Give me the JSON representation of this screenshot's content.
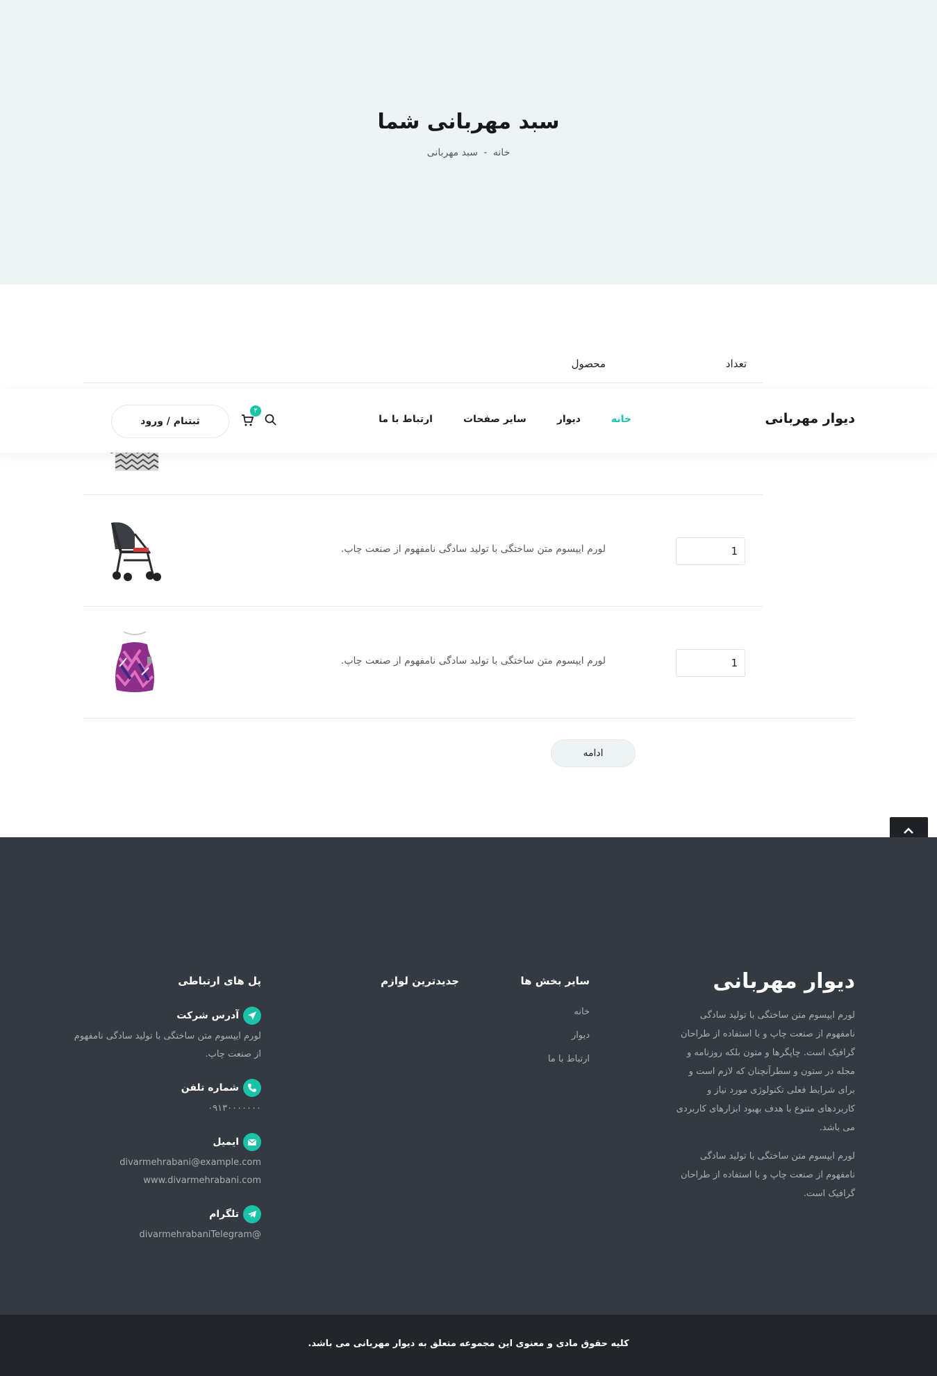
{
  "hero": {
    "title": "سبد مهربانی شما",
    "breadcrumb_home": "خانه",
    "breadcrumb_sep": "-",
    "breadcrumb_current": "سبد مهربانی"
  },
  "cart": {
    "col_quantity": "تعداد",
    "col_product": "محصول",
    "rows": [
      {
        "quantity": "1",
        "description": "لورم ایپسوم متن ساختگی با تولید سادگی نامفهوم از صنعت چاپ.",
        "image": "stroller-icon"
      },
      {
        "quantity": "1",
        "description": "لورم ایپسوم متن ساختگی با تولید سادگی نامفهوم از صنعت چاپ.",
        "image": "swimsuit-icon"
      }
    ],
    "continue_label": "ادامه"
  },
  "navbar": {
    "brand": "دیوار مهربانی",
    "menu": [
      "خانه",
      "دیوار",
      "سایر صفحات",
      "ارتباط با ما"
    ],
    "active_index": 0,
    "cart_count": "۳",
    "login_label": "ثبتنام / ورود"
  },
  "footer": {
    "brand": "دیوار مهربانی",
    "about_1": "لورم ایپسوم متن ساختگی با تولید سادگی نامفهوم از صنعت چاپ و با استفاده از طراحان گرافیک است. چاپگرها و متون بلکه روزنامه و مجله در ستون و سطرآنچنان که لازم است و برای شرایط فعلی تکنولوژی مورد نیاز و کاربردهای متنوع با هدف بهبود ابزارهای کاربردی می باشد.",
    "about_2": "لورم ایپسوم متن ساختگی با تولید سادگی نامفهوم از صنعت چاپ و با استفاده از طراحان گرافیک است.",
    "links_title": "سایر بخش ها",
    "links": [
      "خانه",
      "دیوار",
      "ارتباط با ما"
    ],
    "new_title": "جدیدترین لوازم",
    "contact_title": "پل های ارتباطی",
    "address_label": "آدرس شرکت",
    "address_text": "لورم ایپسوم متن ساختگی با تولید سادگی نامفهوم از صنعت چاپ.",
    "phone_label": "شماره تلفن",
    "phone_text": "۰۹۱۳۰۰۰۰۰۰۰",
    "email_label": "ایمیل",
    "email_text": "divarmehrabani@example.com",
    "website_text": "www.divarmehrabani.com",
    "telegram_label": "تلگرام",
    "telegram_text": "divarmehrabaniTelegram@"
  },
  "copyright": "کلیه حقوق مادی و معنوی این مجموعه متعلق به دیوار مهربانی می باشد.",
  "colors": {
    "accent": "#19c3a8",
    "hero_bg": "#eef3f3",
    "footer_bg": "#343a41",
    "copyright_bg": "#222529"
  }
}
